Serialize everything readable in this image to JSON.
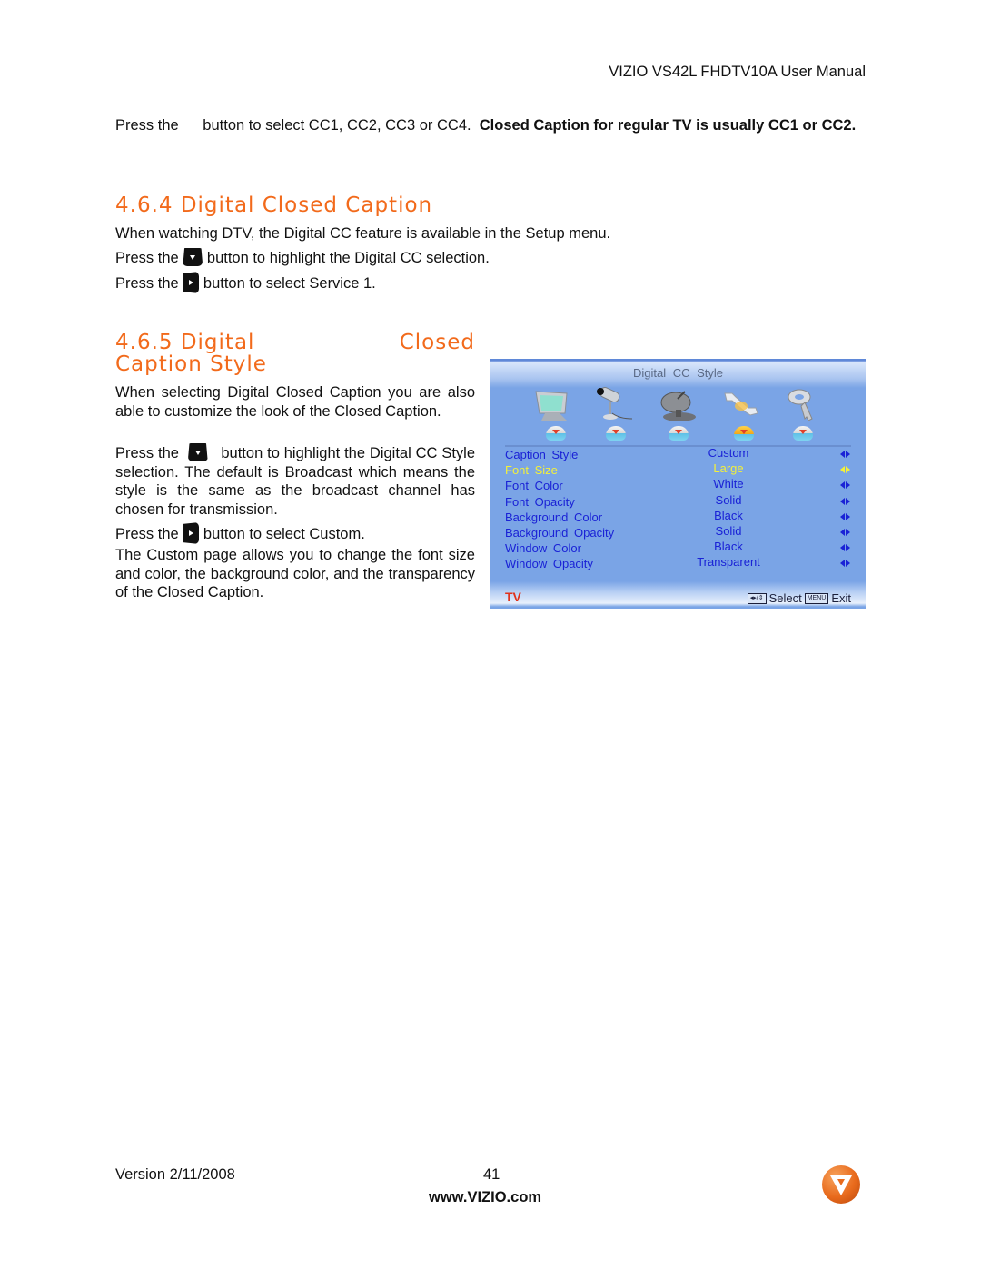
{
  "header": {
    "manual_title": "VIZIO VS42L FHDTV10A User Manual"
  },
  "intro": {
    "press_the": "Press the",
    "text_normal": "button to select CC1, CC2, CC3 or CC4.",
    "text_bold": "Closed Caption for regular TV is usually CC1 or CC2."
  },
  "section_464": {
    "heading": "4.6.4 Digital Closed Caption",
    "line1": "When watching DTV, the Digital CC feature is available in the Setup menu.",
    "line2_pre": "Press the",
    "line2_post": "button to highlight the Digital CC selection.",
    "line2_button_icon": "down-arrow-button-icon",
    "line3_pre": "Press the",
    "line3_post": "button to select Service 1.",
    "line3_button_icon": "right-arrow-button-icon"
  },
  "section_465": {
    "heading_part1": "4.6.5 Digital",
    "heading_part2": "Closed",
    "heading_line2": "Caption Style",
    "para1": "When selecting Digital Closed Caption you are also able to customize the look of the Closed Caption.",
    "para2_pre": "Press the",
    "para2_post": "button to highlight the Digital CC Style selection.  The default is Broadcast which means the style is the same as the broadcast channel has chosen for transmission.",
    "para3_pre": "Press the",
    "para3_post": "button to select Custom.",
    "para4": "The Custom page allows you to change the font size and color, the background color, and the transparency of the Closed Caption."
  },
  "osd": {
    "title": "Digital CC Style",
    "icons": [
      "tv-monitor-icon",
      "video-camera-icon",
      "satellite-dish-icon",
      "wrench-icon",
      "key-icon"
    ],
    "active_icon_index": 3,
    "rows": [
      {
        "label": "Caption Style",
        "value": "Custom"
      },
      {
        "label": "Font Size",
        "value": "Large",
        "highlighted": true
      },
      {
        "label": "Font Color",
        "value": "White"
      },
      {
        "label": "Font Opacity",
        "value": "Solid"
      },
      {
        "label": "Background Color",
        "value": "Black"
      },
      {
        "label": "Background Opacity",
        "value": "Solid"
      },
      {
        "label": "Window Color",
        "value": "Black"
      },
      {
        "label": "Window Opacity",
        "value": "Transparent"
      }
    ],
    "source": "TV",
    "hint_select": "Select",
    "hint_menu_key": "MENU",
    "hint_exit": "Exit",
    "colors": {
      "background": "#7aa4e6",
      "row_text": "#1a22d6",
      "highlight": "#f3f03a",
      "source": "#e0321c"
    }
  },
  "footer": {
    "version": "Version 2/11/2008",
    "page_number": "41",
    "url": "www.VIZIO.com",
    "logo_icon": "vizio-v-logo-icon"
  },
  "colors": {
    "heading": "#f26a1b"
  }
}
